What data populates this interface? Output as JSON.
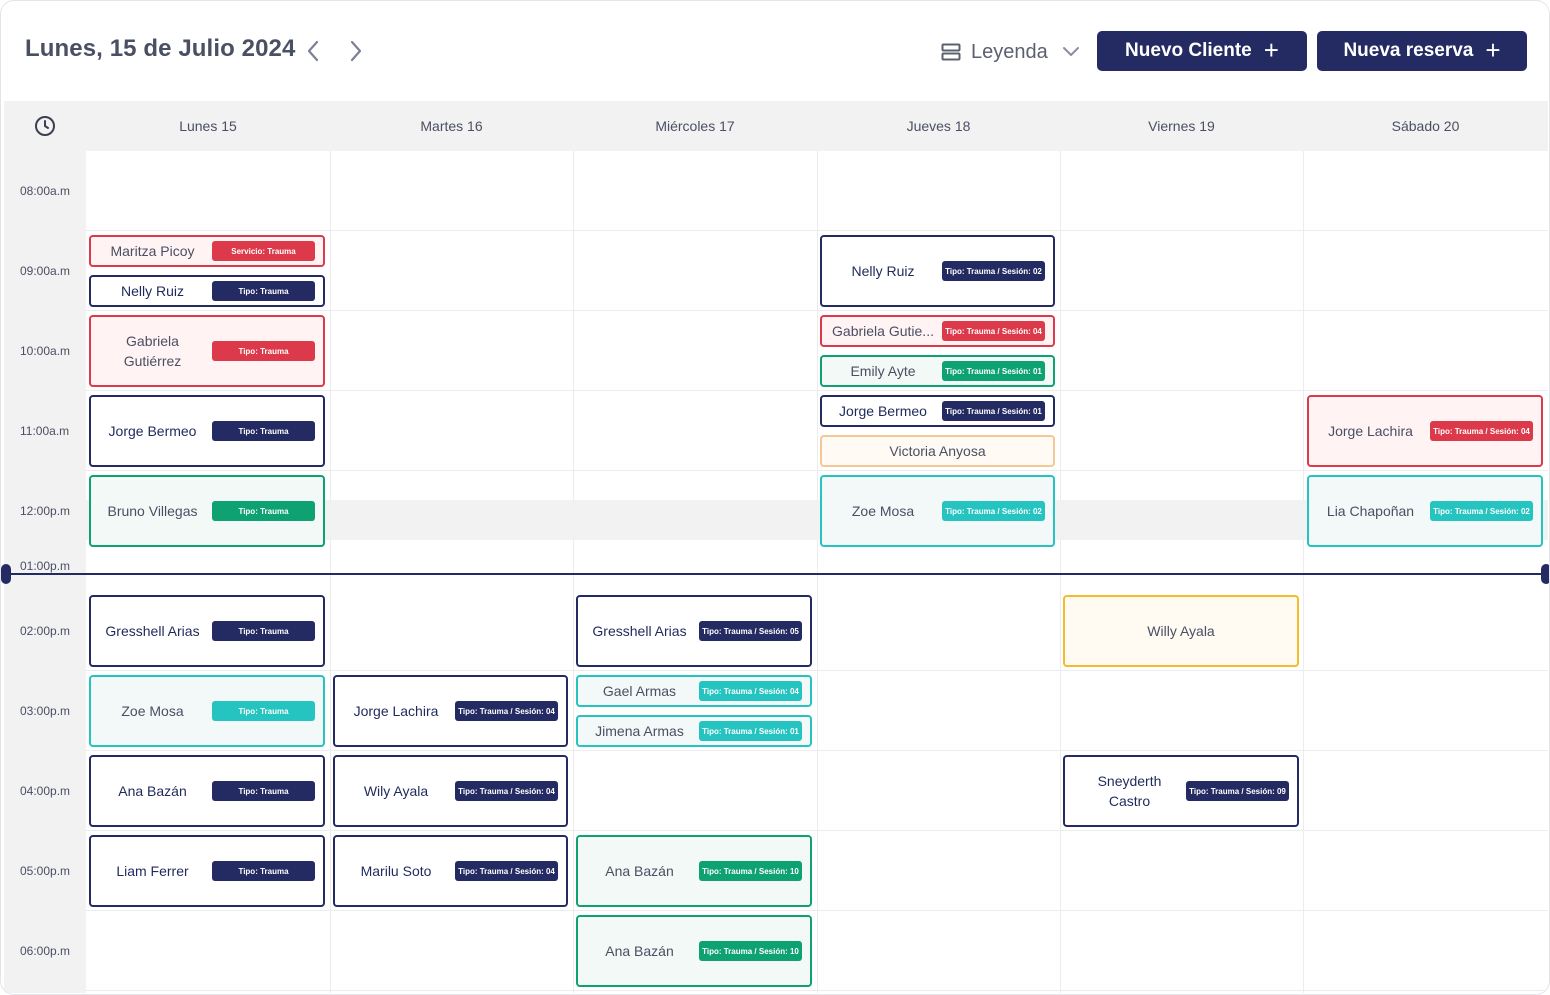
{
  "header": {
    "date_title": "Lunes, 15 de Julio 2024",
    "legend_label": "Leyenda",
    "new_client_label": "Nuevo Cliente",
    "new_booking_label": "Nueva reserva",
    "plus_glyph": "+"
  },
  "days": [
    "Lunes 15",
    "Martes 16",
    "Miércoles 17",
    "Jueves 18",
    "Viernes 19",
    "Sábado 20"
  ],
  "time_slots": [
    "08:00a.m",
    "09:00a.m",
    "10:00a.m",
    "11:00a.m",
    "12:00p.m",
    "01:00p.m",
    "02:00p.m",
    "03:00p.m",
    "04:00p.m",
    "05:00p.m",
    "06:00p.m"
  ],
  "current_time_marker": "01:00p.m",
  "colors": {
    "navy": "#232b62",
    "red": "#dc3a4b",
    "green": "#0ea272",
    "teal": "#25c4c0",
    "orange": "#f4c894",
    "yellow": "#f2bc2a"
  },
  "events": {
    "mon": [
      {
        "name": "Maritza Picoy",
        "badge": "Servicio: Trauma"
      },
      {
        "name": "Nelly Ruiz",
        "badge": "Tipo: Trauma"
      },
      {
        "name": "Gabriela Gutiérrez",
        "badge": "Tipo: Trauma"
      },
      {
        "name": "Jorge Bermeo",
        "badge": "Tipo: Trauma"
      },
      {
        "name": "Bruno Villegas",
        "badge": "Tipo: Trauma"
      },
      {
        "name": "Gresshell Arias",
        "badge": "Tipo: Trauma"
      },
      {
        "name": "Zoe Mosa",
        "badge": "Tipo: Trauma"
      },
      {
        "name": "Ana Bazán",
        "badge": "Tipo: Trauma"
      },
      {
        "name": "Liam Ferrer",
        "badge": "Tipo: Trauma"
      }
    ],
    "tue": [
      {
        "name": "Jorge Lachira",
        "badge": "Tipo: Trauma / Sesión: 04"
      },
      {
        "name": "Wily Ayala",
        "badge": "Tipo: Trauma / Sesión: 04"
      },
      {
        "name": "Marilu Soto",
        "badge": "Tipo: Trauma / Sesión: 04"
      }
    ],
    "wed": [
      {
        "name": "Gresshell Arias",
        "badge": "Tipo: Trauma / Sesión: 05"
      },
      {
        "name": "Gael Armas",
        "badge": "Tipo: Trauma / Sesión: 04"
      },
      {
        "name": "Jimena Armas",
        "badge": "Tipo: Trauma / Sesión: 01"
      },
      {
        "name": "Ana Bazán",
        "badge": "Tipo: Trauma / Sesión: 10"
      },
      {
        "name": "Ana Bazán",
        "badge": "Tipo: Trauma / Sesión: 10"
      }
    ],
    "thu": [
      {
        "name": "Nelly Ruiz",
        "badge": "Tipo: Trauma / Sesión: 02"
      },
      {
        "name": "Gabriela Gutie...",
        "badge": "Tipo: Trauma / Sesión: 04"
      },
      {
        "name": "Emily Ayte",
        "badge": "Tipo: Trauma / Sesión: 01"
      },
      {
        "name": "Jorge Bermeo",
        "badge": "Tipo: Trauma / Sesión: 01"
      },
      {
        "name": "Victoria Anyosa"
      },
      {
        "name": "Zoe Mosa",
        "badge": "Tipo: Trauma / Sesión: 02"
      }
    ],
    "fri": [
      {
        "name": "Willy Ayala"
      },
      {
        "name": "Sneyderth Castro",
        "badge": "Tipo: Trauma / Sesión: 09"
      }
    ],
    "sat": [
      {
        "name": "Jorge Lachira",
        "badge": "Tipo: Trauma / Sesión: 04"
      },
      {
        "name": "Lia Chapoñan",
        "badge": "Tipo: Trauma / Sesión: 02"
      }
    ]
  }
}
